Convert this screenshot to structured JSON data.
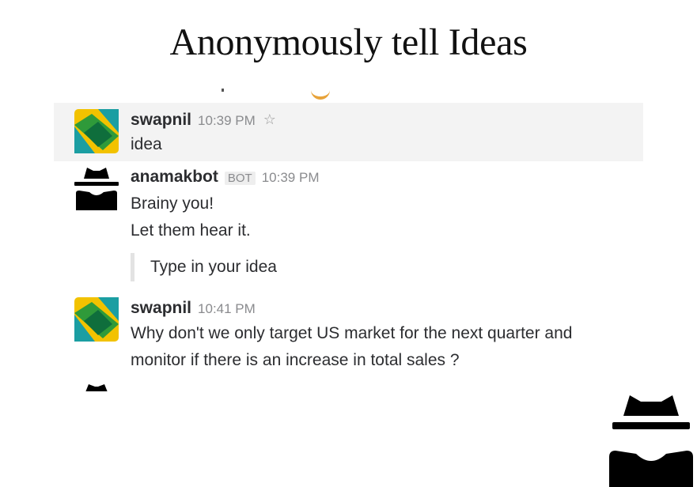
{
  "page": {
    "title": "Anonymously tell Ideas"
  },
  "messages": [
    {
      "sender": "swapnil",
      "time": "10:39 PM",
      "lines": [
        "idea"
      ],
      "highlighted": true,
      "avatar": "slack-logo-avatar",
      "action_icon": "star-icon"
    },
    {
      "sender": "anamakbot",
      "badge": "BOT",
      "time": "10:39 PM",
      "lines": [
        "Brainy you!",
        "Let them hear it."
      ],
      "attachment": "Type in your idea",
      "avatar": "spy-avatar"
    },
    {
      "sender": "swapnil",
      "time": "10:41 PM",
      "lines": [
        "Why don't we only target US market for the next quarter and",
        "monitor if there is an increase in total sales ?"
      ],
      "avatar": "slack-logo-avatar"
    }
  ],
  "colors": {
    "highlight_bg": "#f3f3f3",
    "logo_yellow": "#f2c200",
    "logo_green": "#2f9a3a",
    "logo_teal": "#1b9ea2",
    "logo_dark_green": "#0f6e3c",
    "text": "#2c2d30",
    "muted": "#8a8b8e"
  },
  "decor": {
    "big_icon": "spy-icon"
  }
}
